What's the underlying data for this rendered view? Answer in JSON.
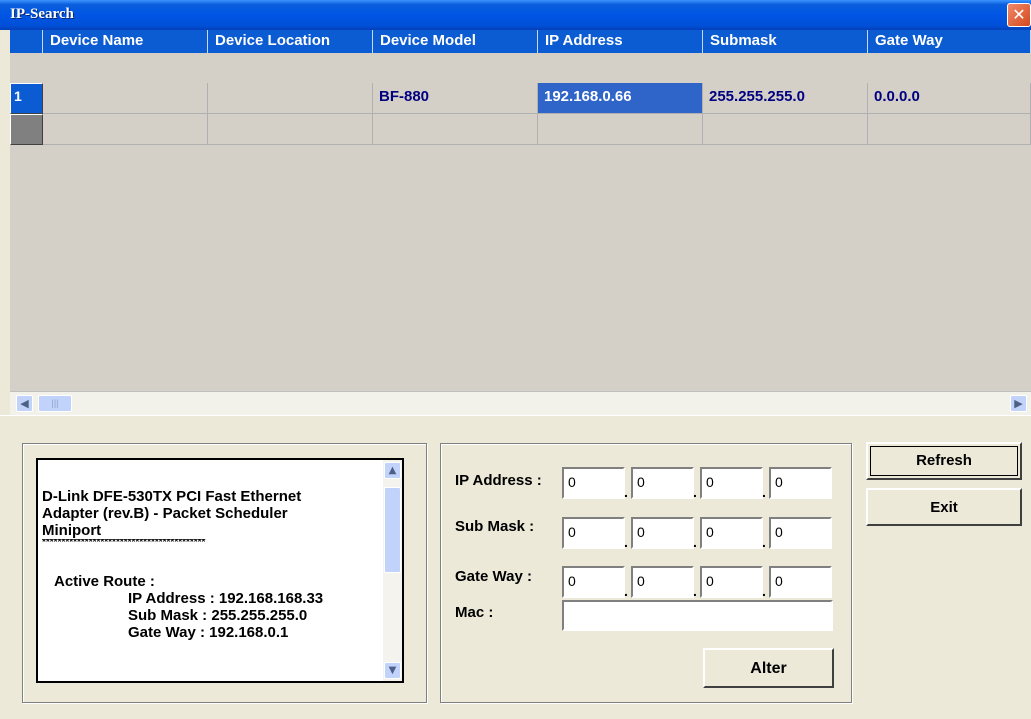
{
  "window": {
    "title": "IP-Search",
    "close_glyph": "✕"
  },
  "grid": {
    "columns": [
      "Device Name",
      "Device Location",
      "Device Model",
      "IP Address",
      "Submask",
      "Gate Way"
    ],
    "rows": [
      {
        "header": "1",
        "cells": [
          "",
          "",
          "BF-880",
          "192.168.0.66",
          "255.255.255.0",
          "0.0.0.0"
        ]
      },
      {
        "header": "",
        "cells": [
          "",
          "",
          "",
          "",
          "",
          ""
        ]
      }
    ]
  },
  "info": {
    "adapter_line1": "D-Link DFE-530TX PCI Fast Ethernet",
    "adapter_line2": "Adapter (rev.B) - Packet Scheduler",
    "adapter_line3": "Miniport",
    "separator": "******************************************",
    "active_route_label": "Active Route :",
    "ip_line": "IP Address : 192.168.168.33",
    "mask_line": "Sub Mask : 255.255.255.0",
    "gw_line": "Gate Way : 192.168.0.1"
  },
  "form": {
    "ip_label": "IP Address :",
    "mask_label": "Sub Mask :",
    "gw_label": "Gate Way :",
    "mac_label": "Mac :",
    "ip": [
      "0",
      "0",
      "0",
      "0"
    ],
    "mask": [
      "0",
      "0",
      "0",
      "0"
    ],
    "gw": [
      "0",
      "0",
      "0",
      "0"
    ],
    "mac": "",
    "octet_separator": "."
  },
  "buttons": {
    "refresh": "Refresh",
    "exit": "Exit",
    "alter": "Alter"
  },
  "colors": {
    "header_blue": "#0b5bd3",
    "selected_cell": "#2f64c8",
    "cell_text": "#000080"
  }
}
